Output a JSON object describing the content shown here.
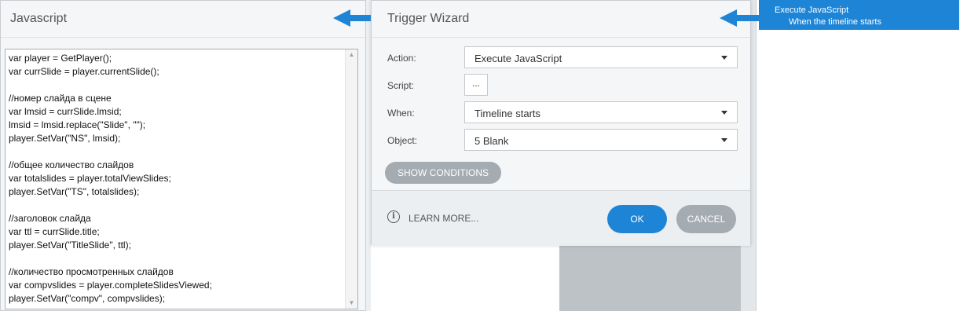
{
  "js_panel": {
    "title": "Javascript",
    "code_lines": [
      "var player = GetPlayer();",
      "var currSlide = player.currentSlide();",
      "",
      "//номер слайда в сцене",
      "var lmsid = currSlide.lmsid;",
      "lmsid = lmsid.replace(\"Slide\", \"\");",
      "player.SetVar(\"NS\", lmsid);",
      "",
      "//общее количество слайдов",
      "var totalslides = player.totalViewSlides;",
      "player.SetVar(\"TS\", totalslides);",
      "",
      "//заголовок слайда",
      "var ttl = currSlide.title;",
      "player.SetVar(\"TitleSlide\", ttl);",
      "",
      "//количество просмотренных слайдов",
      "var compvslides = player.completeSlidesViewed;",
      "player.SetVar(\"compv\", compvslides);"
    ]
  },
  "wizard": {
    "title": "Trigger Wizard",
    "action_label": "Action:",
    "action_value": "Execute JavaScript",
    "script_label": "Script:",
    "script_button": "...",
    "when_label": "When:",
    "when_value": "Timeline starts",
    "object_label": "Object:",
    "object_value": "5 Blank",
    "show_conditions": "SHOW CONDITIONS",
    "learn_more": "LEARN MORE...",
    "ok": "OK",
    "cancel": "CANCEL"
  },
  "callout": {
    "line1": "Execute JavaScript",
    "line2": "When the timeline starts"
  },
  "colors": {
    "accent": "#1e85d6",
    "button_gray": "#a4abb1"
  }
}
